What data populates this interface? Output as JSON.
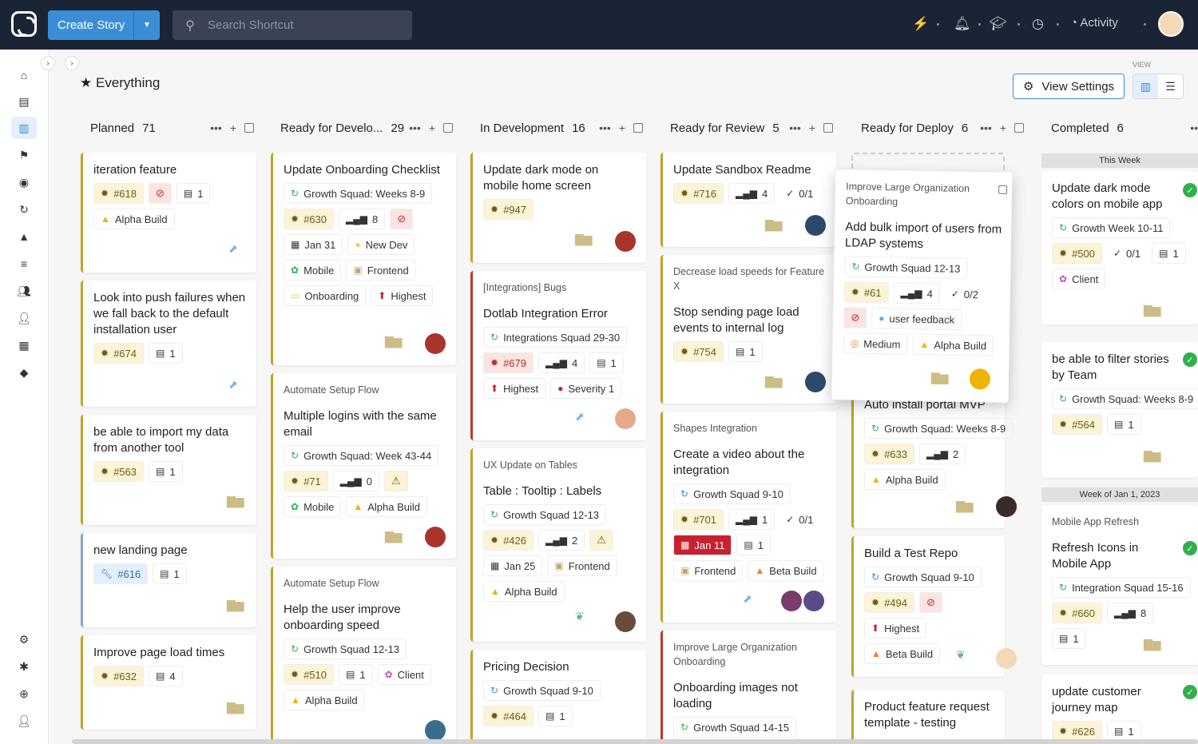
{
  "topbar": {
    "create": "Create Story",
    "search_placeholder": "Search Shortcut",
    "activity": "Activity"
  },
  "page": {
    "title": "Everything",
    "view_label": "VIEW",
    "view_settings": "View Settings"
  },
  "columns": [
    {
      "name": "Planned",
      "count": "71"
    },
    {
      "name": "Ready for Develo...",
      "count": "29"
    },
    {
      "name": "In Development",
      "count": "16"
    },
    {
      "name": "Ready for Review",
      "count": "5"
    },
    {
      "name": "Ready for Deploy",
      "count": "6"
    },
    {
      "name": "Completed",
      "count": "6"
    }
  ],
  "groups": {
    "this_week": "This Week",
    "week_jan": "Week of Jan 1, 2023"
  },
  "cards": {
    "c1": {
      "title": "iteration feature",
      "id": "#618",
      "docs": "1",
      "label": "Alpha Build"
    },
    "c2": {
      "title": "Look into push failures when we fall back to the default installation user",
      "id": "#674",
      "docs": "1"
    },
    "c3": {
      "title": "be able to import my data from another tool",
      "id": "#563",
      "docs": "1"
    },
    "c4": {
      "title": "new landing page",
      "id": "#616",
      "docs": "1"
    },
    "c5": {
      "title": "Improve page load times",
      "id": "#632",
      "docs": "4"
    },
    "r1": {
      "title": "Update Onboarding Checklist",
      "iter": "Growth Squad: Weeks 8-9",
      "id": "#630",
      "est": "8",
      "date": "Jan 31",
      "l1": "New Dev",
      "l2": "Mobile",
      "l3": "Frontend",
      "l4": "Onboarding",
      "prio": "Highest"
    },
    "r2": {
      "epic": "Automate Setup Flow",
      "title": "Multiple logins with the same email",
      "iter": "Growth Squad: Week 43-44",
      "id": "#71",
      "est": "0",
      "l1": "Mobile",
      "l2": "Alpha Build"
    },
    "r3": {
      "epic": "Automate Setup Flow",
      "title": "Help the user improve onboarding speed",
      "iter": "Growth Squad 12-13",
      "id": "#510",
      "docs": "1",
      "l1": "Client",
      "l2": "Alpha Build"
    },
    "d1": {
      "title": "Update dark mode on mobile home screen",
      "id": "#947"
    },
    "d2": {
      "epic": "[Integrations] Bugs",
      "title": "Dotlab Integration Error",
      "iter": "Integrations Squad 29-30",
      "id": "#679",
      "est": "4",
      "docs": "1",
      "prio": "Highest",
      "sev": "Severity 1"
    },
    "d3": {
      "epic": "UX Update on Tables",
      "title": "Table : Tooltip : Labels",
      "iter": "Growth Squad 12-13",
      "id": "#426",
      "est": "2",
      "date": "Jan 25",
      "l1": "Frontend",
      "l2": "Alpha Build"
    },
    "d4": {
      "title": "Pricing Decision",
      "iter": "Growth Squad 9-10",
      "id": "#464",
      "docs": "1"
    },
    "v1": {
      "title": "Update Sandbox Readme",
      "id": "#716",
      "est": "4",
      "tasks": "0/1"
    },
    "v2": {
      "epic": "Decrease load speeds for Feature X",
      "title": "Stop sending page load events to internal log",
      "id": "#754",
      "docs": "1"
    },
    "v3": {
      "epic": "Shapes Integration",
      "title": "Create a video about the integration",
      "iter": "Growth Squad 9-10",
      "id": "#701",
      "est": "1",
      "tasks": "0/1",
      "date": "Jan 11",
      "docs": "1",
      "l1": "Frontend",
      "l2": "Beta Build"
    },
    "v4": {
      "epic": "Improve Large Organization Onboarding",
      "title": "Onboarding images not loading",
      "iter": "Growth Squad 14-15"
    },
    "g0": {
      "epic": "Improve Large Organization Onboarding",
      "title": "Add bulk import of users from LDAP systems",
      "iter": "Growth Squad 12-13",
      "id": "#61",
      "est": "4",
      "tasks": "0/2",
      "l1": "user feedback",
      "prio": "Medium",
      "l2": "Alpha Build"
    },
    "g1": {
      "title": "Auto install portal MVP",
      "iter": "Growth Squad: Weeks 8-9",
      "id": "#633",
      "est": "2",
      "l1": "Alpha Build"
    },
    "g2": {
      "title": "Build a Test Repo",
      "iter": "Growth Squad 9-10",
      "id": "#494",
      "prio": "Highest",
      "l1": "Beta Build"
    },
    "g3": {
      "title": "Product feature request template - testing"
    },
    "k1": {
      "title": "Update dark mode colors on mobile app",
      "iter": "Growth Week 10-11",
      "id": "#500",
      "tasks": "0/1",
      "docs": "1",
      "l1": "Client"
    },
    "k2": {
      "title": "be able to filter stories by Team",
      "iter": "Growth Squad: Weeks 8-9",
      "id": "#564",
      "docs": "1"
    },
    "k3": {
      "epic": "Mobile App Refresh",
      "title": "Refresh Icons in Mobile App",
      "iter": "Integration Squad 15-16",
      "id": "#660",
      "est": "8",
      "docs": "1"
    },
    "k4": {
      "title": "update customer journey map",
      "id": "#626",
      "docs": "1"
    }
  }
}
